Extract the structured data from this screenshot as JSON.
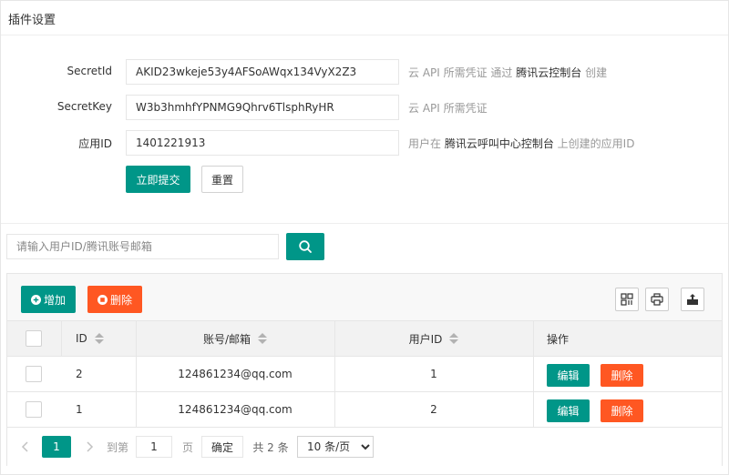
{
  "header": {
    "title": "插件设置"
  },
  "form": {
    "secret_id": {
      "label": "SecretId",
      "value": "AKID23wkeje53y4AFSoAWqx134VyX2Z3",
      "tip_prefix": "云 API 所需凭证 通过 ",
      "tip_link": "腾讯云控制台",
      "tip_suffix": " 创建"
    },
    "secret_key": {
      "label": "SecretKey",
      "value": "W3b3hmhfYPNMG9Qhrv6TlsphRyHR",
      "tip": "云 API 所需凭证"
    },
    "app_id": {
      "label": "应用ID",
      "value": "1401221913",
      "tip_prefix": "用户在 ",
      "tip_link": "腾讯云呼叫中心控制台",
      "tip_suffix": " 上创建的应用ID"
    },
    "submit_label": "立即提交",
    "reset_label": "重置"
  },
  "search": {
    "placeholder": "请输入用户ID/腾讯账号邮箱",
    "icon": "search-icon"
  },
  "toolbar": {
    "add_label": "增加",
    "delete_label": "删除",
    "add_icon": "plus-circle-icon",
    "delete_icon": "stop-circle-icon",
    "right_icons": [
      "columns-icon",
      "print-icon",
      "export-icon"
    ]
  },
  "table": {
    "columns": [
      "ID",
      "账号/邮箱",
      "用户ID",
      "操作"
    ],
    "rows": [
      {
        "id": "2",
        "account": "124861234@qq.com",
        "user_id": "1",
        "edit_label": "编辑",
        "delete_label": "删除"
      },
      {
        "id": "1",
        "account": "124861234@qq.com",
        "user_id": "2",
        "edit_label": "编辑",
        "delete_label": "删除"
      }
    ]
  },
  "pagination": {
    "current_page": "1",
    "goto_label": "到第",
    "goto_value": "1",
    "page_unit": "页",
    "confirm_label": "确定",
    "total_label": "共 2 条",
    "page_size_selected": "10 条/页"
  },
  "colors": {
    "primary": "#009688",
    "danger": "#ff5722",
    "tip": "#999999"
  }
}
